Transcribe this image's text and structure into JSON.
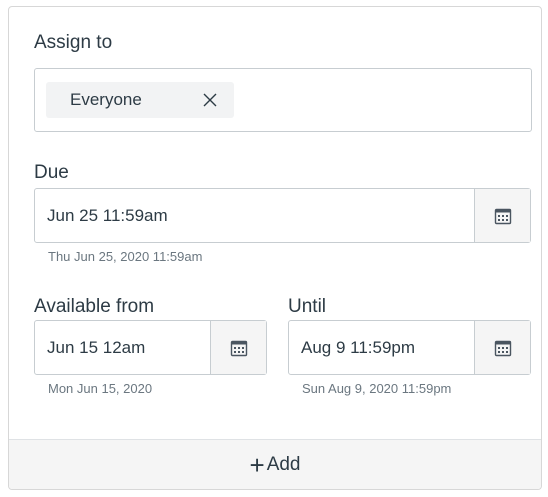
{
  "assign": {
    "label": "Assign to",
    "tag": "Everyone"
  },
  "due": {
    "label": "Due",
    "value": "Jun 25 11:59am",
    "hint": "Thu Jun 25, 2020 11:59am"
  },
  "available_from": {
    "label": "Available from",
    "value": "Jun 15 12am",
    "hint": "Mon Jun 15, 2020"
  },
  "until": {
    "label": "Until",
    "value": "Aug 9 11:59pm",
    "hint": "Sun Aug 9, 2020 11:59pm"
  },
  "footer": {
    "plus": "+",
    "add_label": "Add"
  },
  "icons": {
    "calendar": "calendar-icon",
    "remove": "close-icon"
  }
}
